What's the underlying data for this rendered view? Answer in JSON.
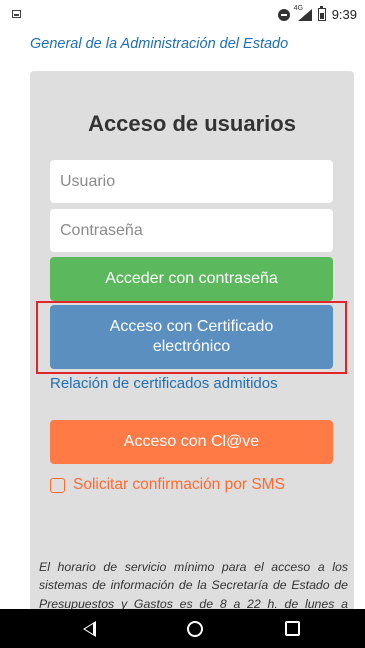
{
  "status_bar": {
    "time": "9:39",
    "network_label": "4G",
    "icons": [
      "notification-icon",
      "do-not-disturb-icon",
      "signal-icon",
      "battery-icon"
    ]
  },
  "header": {
    "link_text": "General de la Administración del Estado"
  },
  "login": {
    "title": "Acceso de usuarios",
    "username_placeholder": "Usuario",
    "password_placeholder": "Contraseña",
    "password_button": "Acceder con contraseña",
    "certificate_button": "Acceso con Certificado electrónico",
    "certificates_link": "Relación de certificados admitidos",
    "clave_button": "Acceso con Cl@ve",
    "sms_label": "Solicitar confirmación por SMS",
    "sms_checked": false
  },
  "footer": {
    "notice": "El horario de servicio mínimo para el acceso a los sistemas de información de la Secretaría de Estado de Presupuestos y Gastos es de 8 a 22 h. de lunes a viernes."
  },
  "colors": {
    "link": "#1f6fb2",
    "green_button": "#5cb85c",
    "blue_button": "#5b8fc0",
    "orange_button": "#ff7a45",
    "highlight_border": "#e0262b",
    "panel": "#dedede"
  },
  "nav_bar": {
    "icons": [
      "back-icon",
      "home-icon",
      "recents-icon"
    ]
  }
}
